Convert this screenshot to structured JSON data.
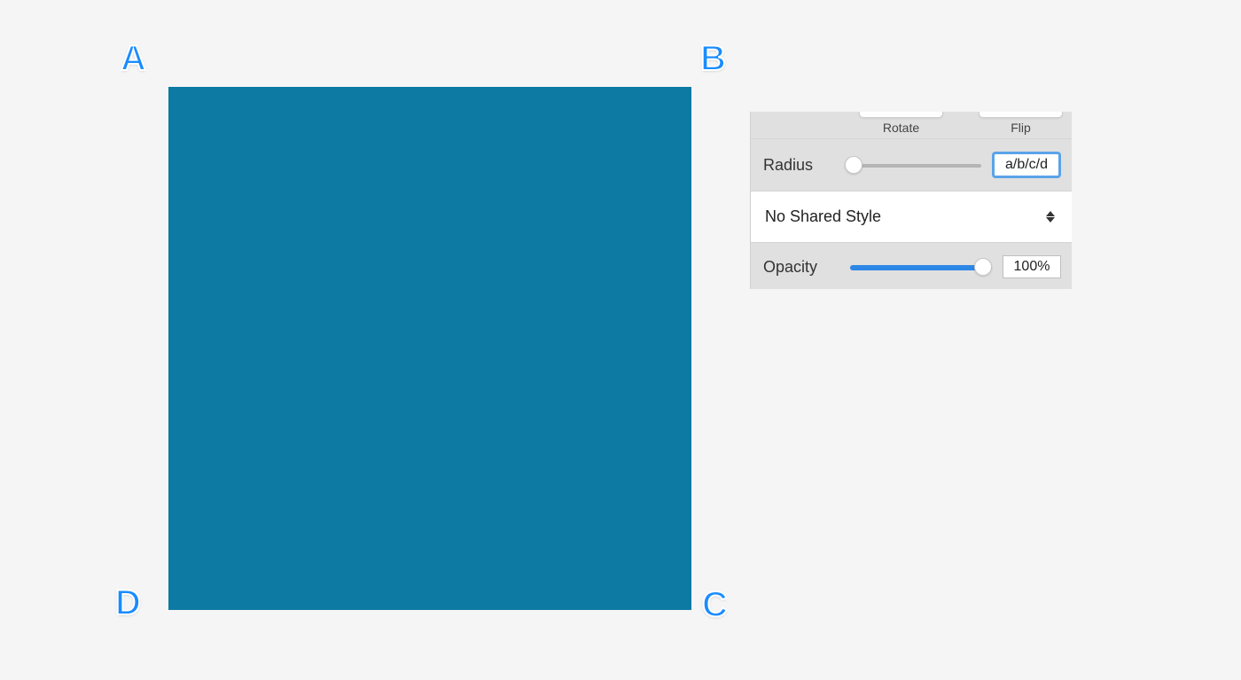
{
  "canvas": {
    "shape_fill": "#0d7aa3",
    "corners": {
      "a": "A",
      "b": "B",
      "c": "C",
      "d": "D"
    }
  },
  "inspector": {
    "rotate_label": "Rotate",
    "flip_label": "Flip",
    "radius": {
      "label": "Radius",
      "value": "a/b/c/d"
    },
    "style": {
      "label": "No Shared Style"
    },
    "opacity": {
      "label": "Opacity",
      "value": "100%"
    }
  }
}
